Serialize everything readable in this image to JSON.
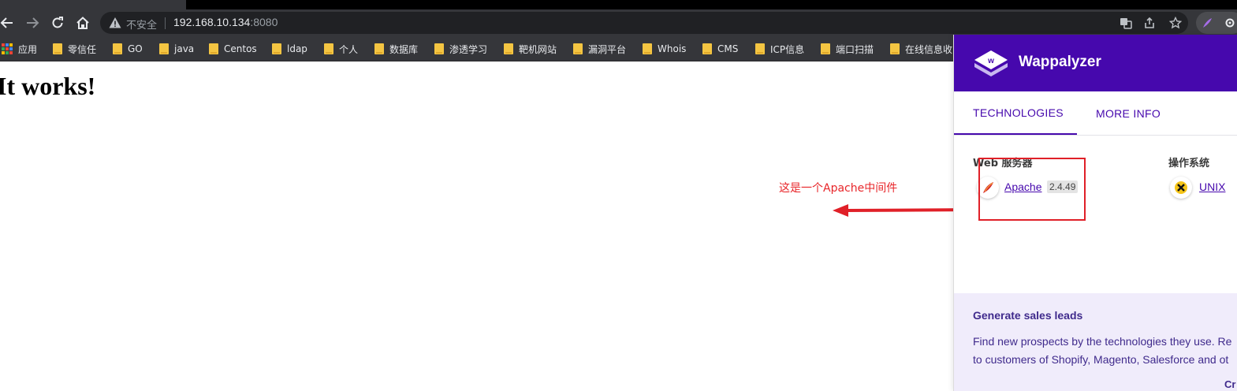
{
  "browser": {
    "security_label": "不安全",
    "url_host": "192.168.10.134",
    "url_port": ":8080",
    "icons": [
      "back-arrow-icon",
      "forward-arrow-icon",
      "reload-icon",
      "home-icon",
      "warning-icon",
      "translate-icon",
      "share-icon",
      "star-icon",
      "extension-feather-icon",
      "extension-gear-icon"
    ]
  },
  "bookmarks": {
    "apps_label": "应用",
    "items": [
      "零信任",
      "GO",
      "java",
      "Centos",
      "ldap",
      "个人",
      "数据库",
      "渗透学习",
      "靶机网站",
      "漏洞平台",
      "Whois",
      "CMS",
      "ICP信息",
      "端口扫描",
      "在线信息收"
    ]
  },
  "page": {
    "heading": "It works!"
  },
  "annotation": {
    "text": "这是一个Apache中间件",
    "color": "#e8262a"
  },
  "wappalyzer": {
    "title": "Wappalyzer",
    "brand_color": "#4608ad",
    "tabs": [
      "TECHNOLOGIES",
      "MORE INFO"
    ],
    "active_tab": "TECHNOLOGIES",
    "categories": [
      {
        "name": "Web 服务器",
        "tech": "Apache",
        "version": "2.4.49",
        "icon": "apache-feather-icon"
      },
      {
        "name": "操作系统",
        "tech": "UNIX",
        "version": "",
        "icon": "unix-x-icon"
      }
    ],
    "promo": {
      "title": "Generate sales leads",
      "line1": "Find new prospects by the technologies they use. Re",
      "line2": "to customers of Shopify, Magento, Salesforce and ot",
      "cta": "Cr"
    }
  }
}
